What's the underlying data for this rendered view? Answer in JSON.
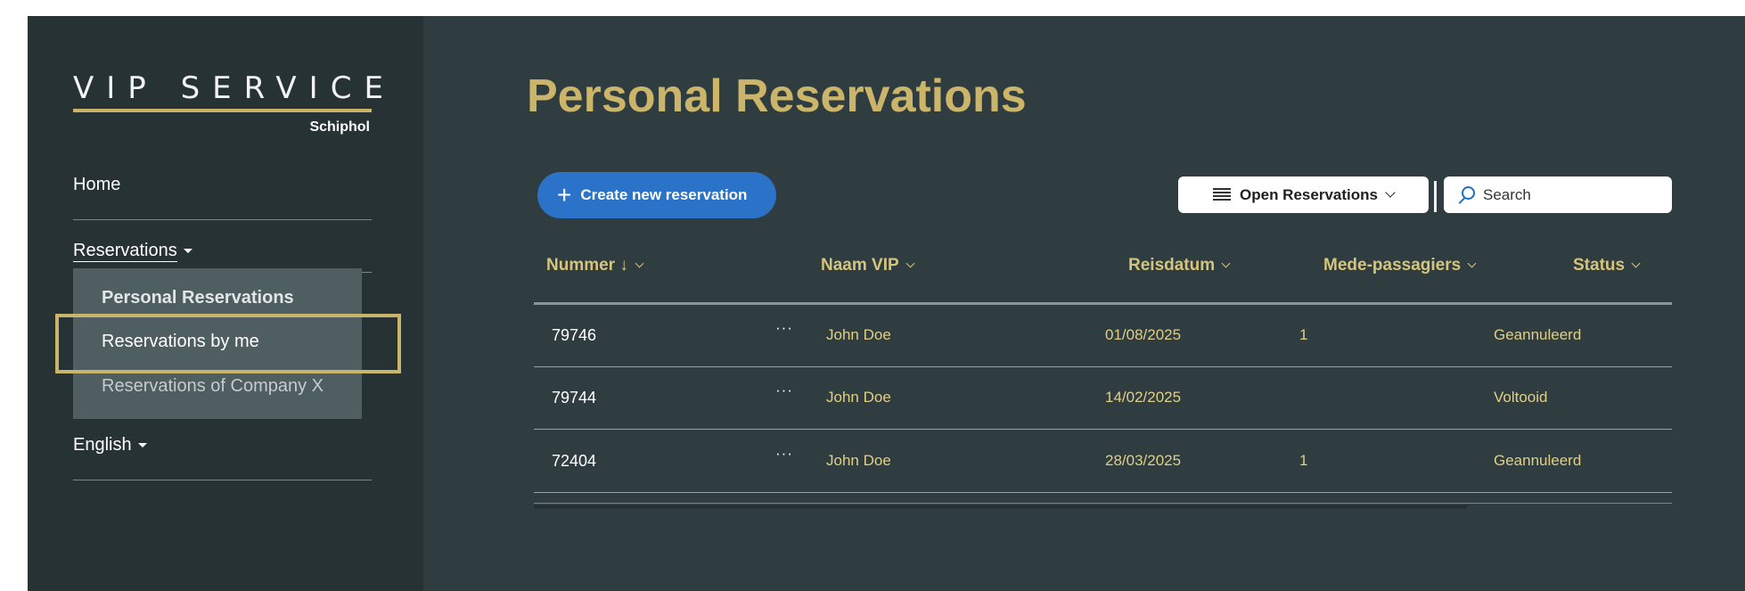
{
  "brand": {
    "title": "VIP SERVICE",
    "subtitle": "Schiphol"
  },
  "sidebar": {
    "home": "Home",
    "reservations": "Reservations",
    "dropdown": [
      "Personal Reservations",
      "Reservations by me",
      "Reservations of Company X"
    ],
    "language": "English"
  },
  "page": {
    "title": "Personal Reservations"
  },
  "toolbar": {
    "create_label": "Create new reservation",
    "filter_label": "Open Reservations",
    "search_placeholder": "Search"
  },
  "table": {
    "headers": [
      "Nummer ↓",
      "Naam VIP",
      "Reisdatum",
      "Mede-passagiers",
      "Status"
    ],
    "rows": [
      {
        "nummer": "79746",
        "more": "···",
        "naam": "John Doe",
        "reisdatum": "01/08/2025",
        "mede": "1",
        "status": "Geannuleerd"
      },
      {
        "nummer": "79744",
        "more": "···",
        "naam": "John Doe",
        "reisdatum": "14/02/2025",
        "mede": "",
        "status": "Voltooid"
      },
      {
        "nummer": "72404",
        "more": "···",
        "naam": "John Doe",
        "reisdatum": "28/03/2025",
        "mede": "1",
        "status": "Geannuleerd"
      }
    ]
  },
  "colors": {
    "accent_gold": "#cbb56a",
    "primary_blue": "#2b73c9",
    "background": "#2f3d40",
    "sidebar": "#263234"
  },
  "icons": {
    "create": "plus-icon",
    "filter": "list-icon",
    "search": "search-icon",
    "row_action": "more-icon"
  }
}
